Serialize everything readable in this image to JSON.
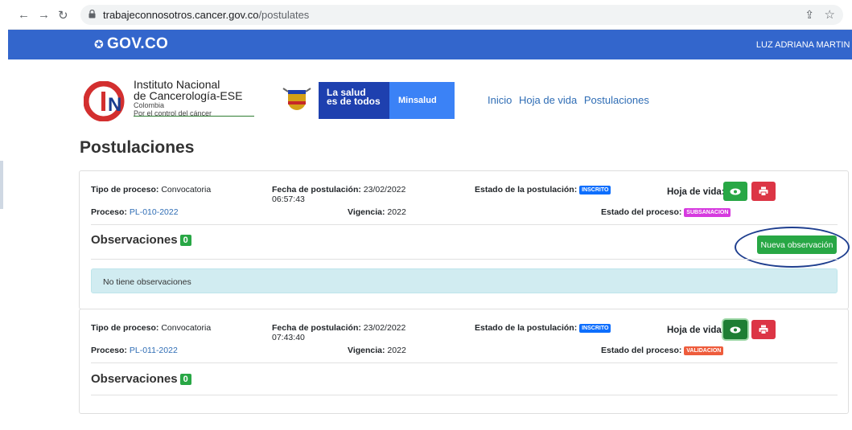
{
  "browser": {
    "url_host": "trabajeconnosotros.cancer.gov.co",
    "url_path": "/postulates"
  },
  "govbar": {
    "logo": "GOV.CO",
    "user": "LUZ ADRIANA MARTIN J"
  },
  "header": {
    "inc_line1": "Instituto Nacional",
    "inc_line2": "de Cancerología-ESE",
    "inc_line3": "Colombia",
    "inc_line4": "Por el control del cáncer",
    "salud_line1": "La salud",
    "salud_line2": "es de todos",
    "minsalud": "Minsalud",
    "menu": [
      "Inicio",
      "Hoja de vida",
      "Postulaciones"
    ]
  },
  "page_title": "Postulaciones",
  "labels": {
    "tipo": "Tipo de proceso:",
    "fecha": "Fecha de postulación:",
    "estado_post": "Estado de la postulación:",
    "hoja": "Hoja de vida:",
    "proceso": "Proceso:",
    "vigencia": "Vigencia:",
    "estado_proc": "Estado del proceso:",
    "observaciones": "Observaciones",
    "new_obs": "Nueva observación",
    "no_obs": "No tiene observaciones"
  },
  "postulations": [
    {
      "tipo": "Convocatoria",
      "fecha_date": "23/02/2022",
      "fecha_time": "06:57:43",
      "estado_post": "INSCRITO",
      "proceso": "PL-010-2022",
      "vigencia": "2022",
      "estado_proc": "SUBSANACION",
      "obs_count": "0"
    },
    {
      "tipo": "Convocatoria",
      "fecha_date": "23/02/2022",
      "fecha_time": "07:43:40",
      "estado_post": "INSCRITO",
      "proceso": "PL-011-2022",
      "vigencia": "2022",
      "estado_proc": "VALIDACION",
      "obs_count": "0"
    }
  ],
  "colors": {
    "gov_blue": "#3366cc",
    "success": "#28a745",
    "danger": "#dc3545",
    "badge_inscrito": "#0d6efd",
    "badge_subsanacion": "#d63adf",
    "badge_validacion": "#ee5c3c"
  }
}
